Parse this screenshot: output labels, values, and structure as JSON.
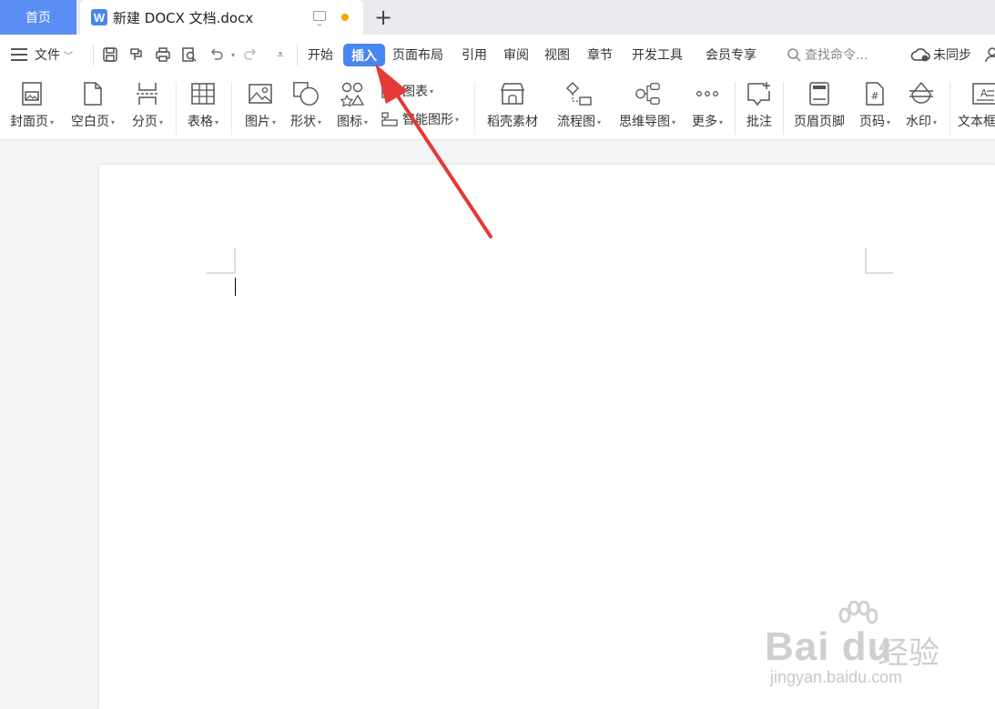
{
  "tabs": {
    "home": "首页",
    "doc_title": "新建 DOCX 文档.docx",
    "doc_icon_letter": "W",
    "new_tab": "+"
  },
  "menu": {
    "file": "文件",
    "items": [
      "开始",
      "插入",
      "页面布局",
      "引用",
      "审阅",
      "视图",
      "章节",
      "开发工具",
      "会员专享"
    ],
    "active": "插入",
    "search_placeholder": "查找命令...",
    "sync_status": "未同步"
  },
  "ribbon": {
    "cover": "封面页",
    "blank": "空白页",
    "page_break": "分页",
    "table": "表格",
    "picture": "图片",
    "shape": "形状",
    "icon": "图标",
    "chart": "图表",
    "smart_art": "智能图形",
    "docer": "稻壳素材",
    "flowchart": "流程图",
    "mindmap": "思维导图",
    "more": "更多",
    "comment": "批注",
    "header_footer": "页眉页脚",
    "page_number": "页码",
    "watermark": "水印",
    "textbox": "文本框"
  },
  "watermark_text": {
    "main": "Bai du",
    "cn": "经验",
    "sub": "jingyan.baidu.com"
  },
  "colors": {
    "accent": "#4a86f0",
    "home_tab": "#5a8ef5",
    "arrow": "#e53935",
    "modified_dot": "#f0a500"
  }
}
